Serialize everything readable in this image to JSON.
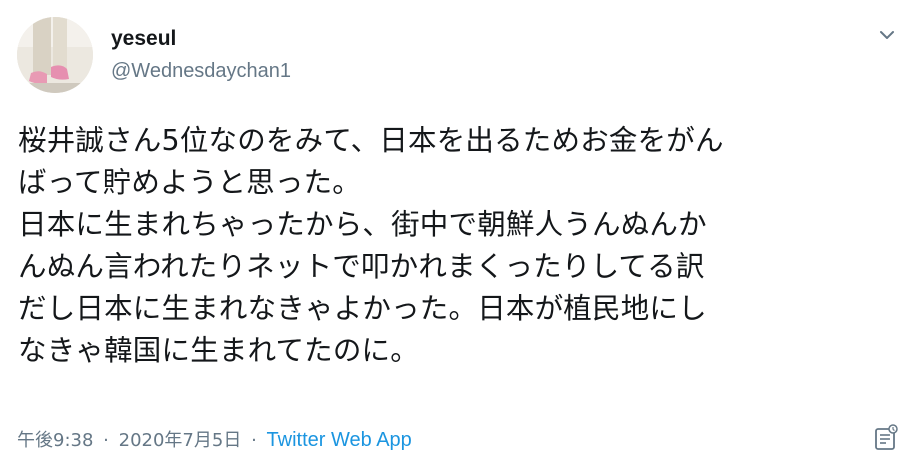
{
  "author": {
    "display_name": "yeseul",
    "handle": "@Wednesdaychan1",
    "avatar_icon": "avatar-photo-pink-shoes"
  },
  "tweet": {
    "lines": [
      "桜井誠さん5位なのをみて、日本を出るためお金をがん",
      "ばって貯めようと思った。",
      "日本に生まれちゃったから、街中で朝鮮人うんぬんか",
      "んぬん言われたりネットで叩かれまくったりしてる訳",
      "だし日本に生まれなきゃよかった。日本が植民地にし",
      "なきゃ韓国に生まれてたのに。"
    ]
  },
  "meta": {
    "time": "午後9:38",
    "separator": "·",
    "date": "2020年7月5日",
    "source": "Twitter Web App"
  },
  "icons": {
    "menu": "chevron-down-icon",
    "analytics": "analytics-icon"
  },
  "colors": {
    "text": "#14171a",
    "secondary": "#657786",
    "link": "#1b95e0"
  }
}
